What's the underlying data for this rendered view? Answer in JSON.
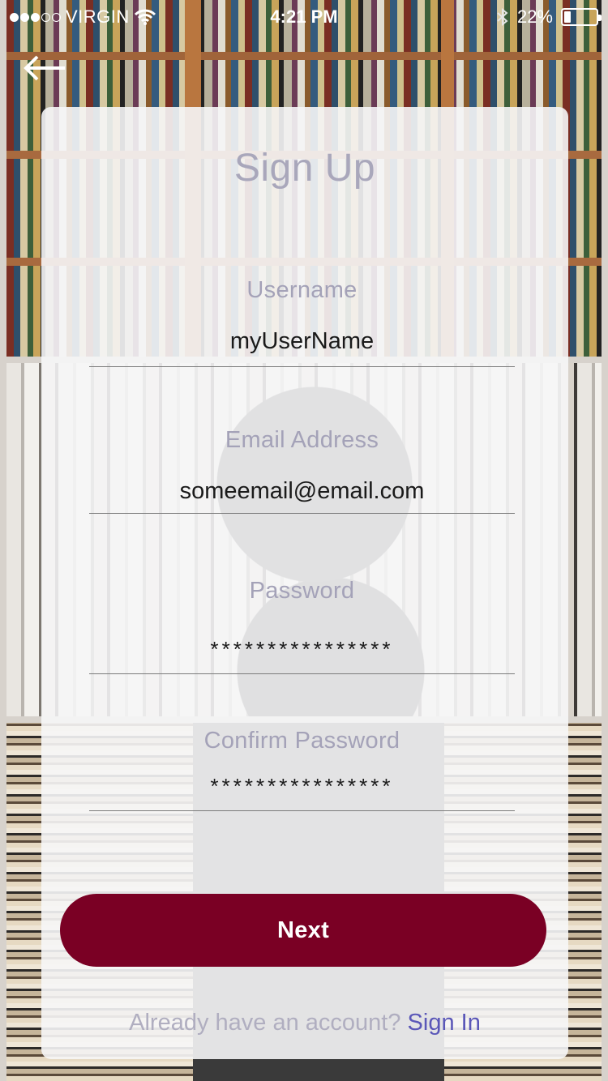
{
  "status_bar": {
    "signal_filled": 3,
    "signal_total": 5,
    "carrier": "VIRGIN",
    "time": "4:21 PM",
    "battery_text": "22%",
    "battery_level": 0.22
  },
  "nav": {
    "back_icon": "arrow-left-icon"
  },
  "form": {
    "title": "Sign Up",
    "fields": [
      {
        "label": "Username",
        "value": "myUserName",
        "type": "text"
      },
      {
        "label": "Email Address",
        "value": "someemail@email.com",
        "type": "email"
      },
      {
        "label": "Password",
        "value": "****************",
        "type": "password"
      },
      {
        "label": "Confirm Password",
        "value": "****************",
        "type": "password"
      }
    ],
    "submit_label": "Next",
    "signin_prompt": "Already have an account?",
    "signin_link": "Sign In"
  },
  "colors": {
    "primary_button": "#7a0024",
    "link": "#5a57b8",
    "label": "#a4a2b8"
  }
}
